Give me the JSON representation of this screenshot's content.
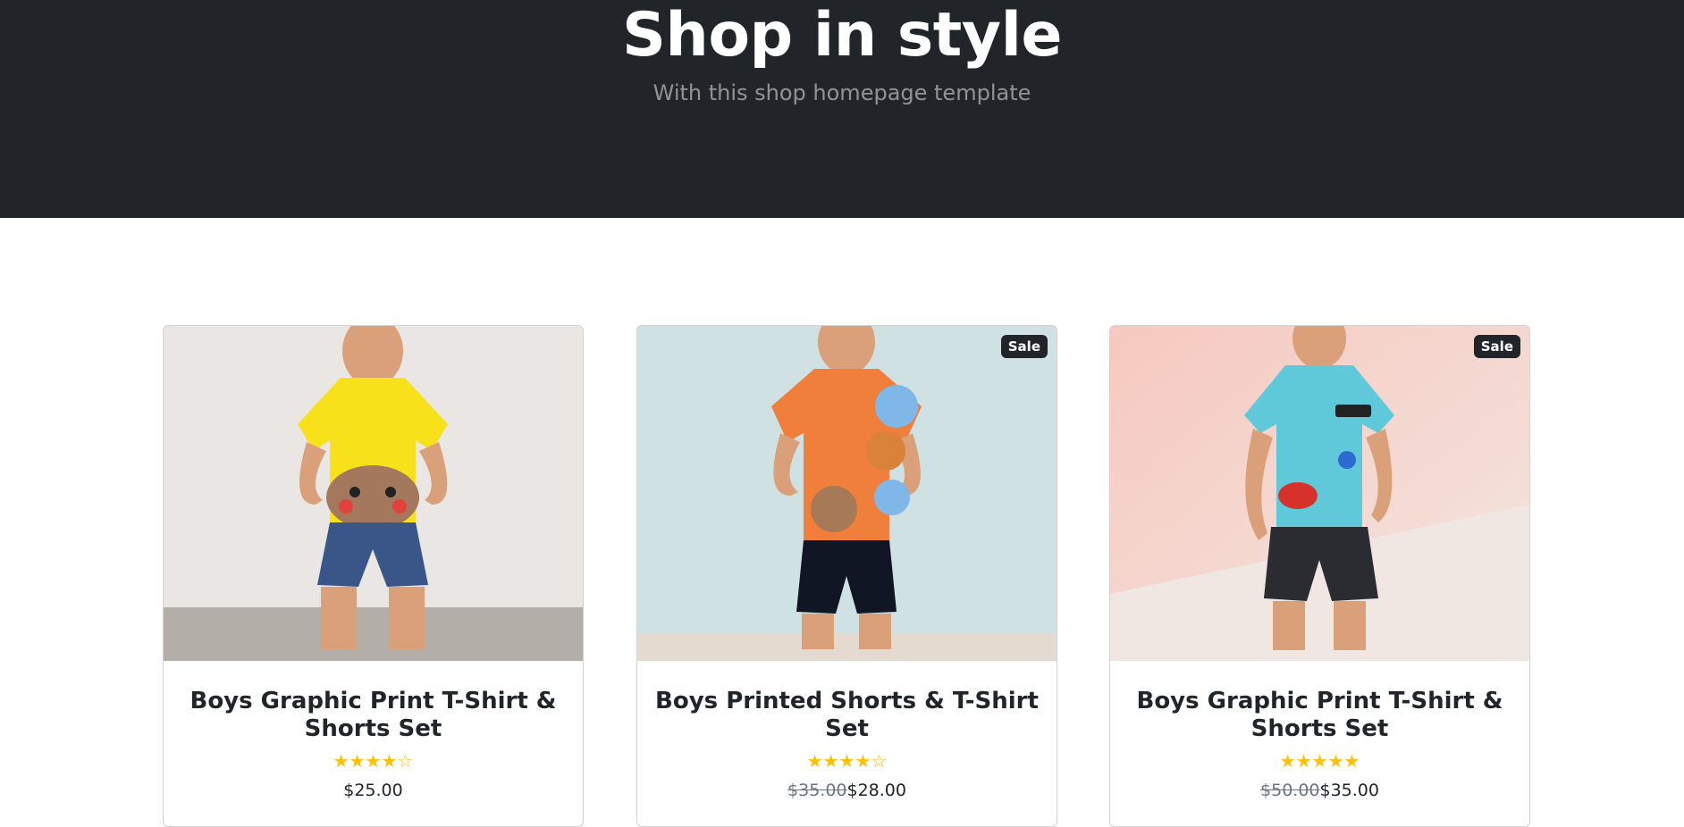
{
  "hero": {
    "title": "Shop in style",
    "subtitle": "With this shop homepage template"
  },
  "products": [
    {
      "name": "Boys Graphic Print T-Shirt & Shorts Set",
      "image_alt": "boy in yellow polo and denim shorts",
      "badge": "",
      "rating": 4,
      "stars": "★★★★☆",
      "old_price": "",
      "price": "$25.00"
    },
    {
      "name": "Boys Printed Shorts & T-Shirt Set",
      "image_alt": "boy in orange printed t-shirt and black shorts",
      "badge": "Sale",
      "rating": 4,
      "stars": "★★★★☆",
      "old_price": "$35.00",
      "price": "$28.00"
    },
    {
      "name": "Boys Graphic Print T-Shirt & Shorts Set",
      "image_alt": "boy in blue polo and black shorts",
      "badge": "Sale",
      "rating": 5,
      "stars": "★★★★★",
      "old_price": "$50.00",
      "price": "$35.00"
    }
  ],
  "colors": {
    "hero_bg": "#212529",
    "star": "#ffc107",
    "badge_bg": "#212529"
  }
}
